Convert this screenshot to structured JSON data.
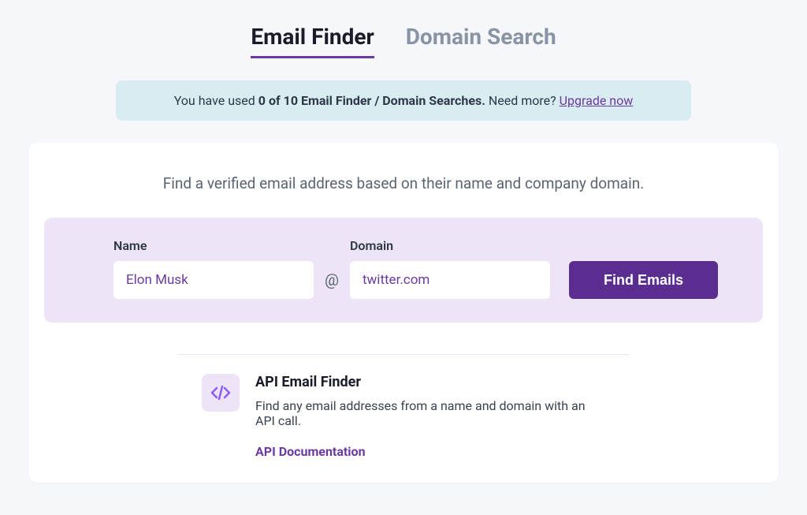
{
  "tabs": {
    "email_finder": "Email Finder",
    "domain_search": "Domain Search"
  },
  "banner": {
    "prefix": "You have used ",
    "bold": "0 of 10 Email Finder / Domain Searches.",
    "suffix": " Need more? ",
    "link": "Upgrade now"
  },
  "subtitle": "Find a verified email address based on their name and company domain.",
  "form": {
    "name_label": "Name",
    "name_value": "Elon Musk",
    "at": "@",
    "domain_label": "Domain",
    "domain_value": "twitter.com",
    "button": "Find Emails"
  },
  "api": {
    "title": "API Email Finder",
    "description": "Find any email addresses from a name and domain with an API call.",
    "link": "API Documentation"
  }
}
